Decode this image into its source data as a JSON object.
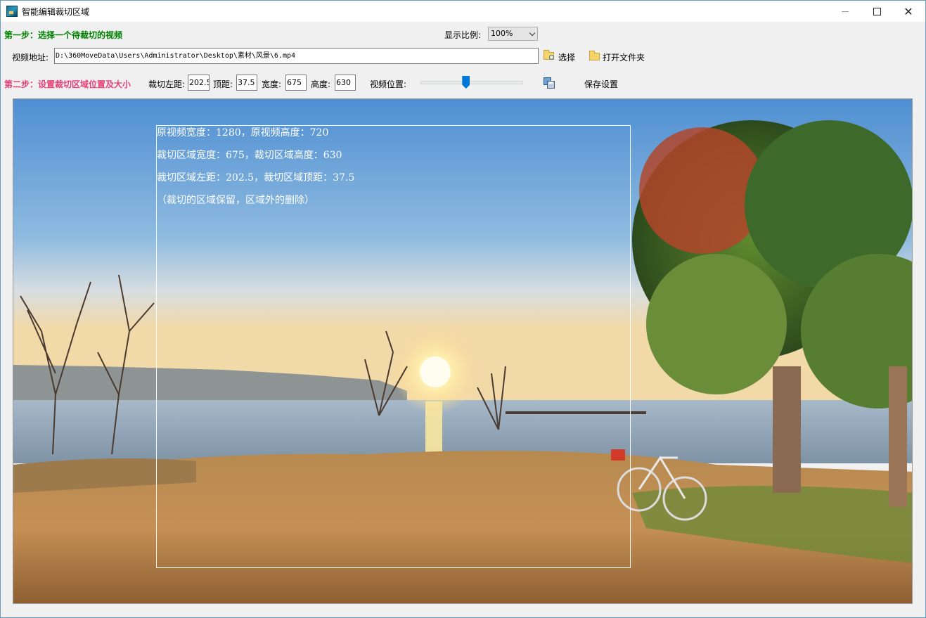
{
  "window": {
    "title": "智能编辑裁切区域",
    "close_symbol": "✕"
  },
  "step1": {
    "label": "第一步：选择一个待裁切的视频",
    "ratio_label": "显示比例:",
    "ratio_value": "100%",
    "address_label": "视频地址:",
    "address_value": "D:\\360MoveData\\Users\\Administrator\\Desktop\\素材\\风景\\6.mp4",
    "select_label": "选择",
    "open_folder_label": "打开文件夹"
  },
  "step2": {
    "label": "第二步：设置裁切区域位置及大小",
    "left_label": "裁切左距:",
    "left_value": "202.5",
    "top_label": "顶距:",
    "top_value": "37.5",
    "width_label": "宽度:",
    "width_value": "675",
    "height_label": "高度:",
    "height_value": "630",
    "position_label": "视频位置:",
    "position_fraction": 0.45,
    "save_label": "保存设置"
  },
  "overlay": {
    "line1": "原视频宽度：1280，原视频高度：720",
    "line2": "裁切区域宽度：675，裁切区域高度：630",
    "line3": "裁切区域左距：202.5，裁切区域顶距：37.5",
    "line4": "（裁切的区域保留，区域外的删除）"
  },
  "icons": {
    "app": "app-icon",
    "select": "folder-search-icon",
    "open_folder": "folder-icon",
    "save": "save-settings-icon"
  },
  "colors": {
    "step1": "#008000",
    "step2": "#e8417a",
    "slider": "#0078d7"
  }
}
